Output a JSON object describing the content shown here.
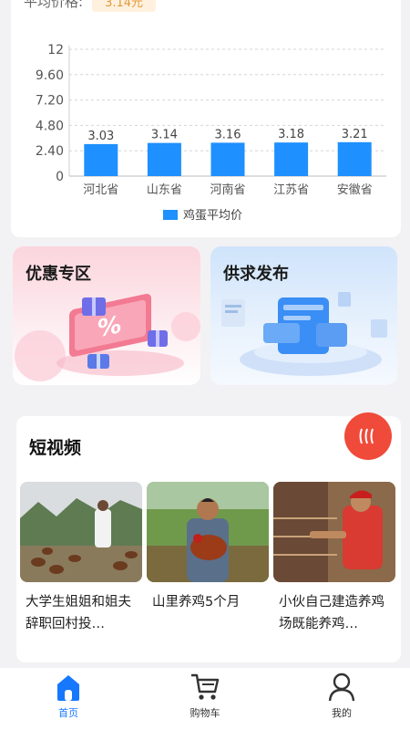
{
  "header": {
    "price_label": "平均价格:",
    "price_value": "3.14元"
  },
  "chart_data": {
    "type": "bar",
    "categories": [
      "河北省",
      "山东省",
      "河南省",
      "江苏省",
      "安徽省"
    ],
    "series": [
      {
        "name": "鸡蛋平均价",
        "values": [
          3.03,
          3.14,
          3.16,
          3.18,
          3.21
        ]
      }
    ],
    "yticks": [
      "0",
      "2.40",
      "4.80",
      "7.20",
      "9.60",
      "12"
    ],
    "ylim": [
      0,
      12
    ],
    "grid": true,
    "legend": "bottom",
    "bar_color": "#1e90ff"
  },
  "promos": {
    "discount_title": "优惠专区",
    "supply_title": "供求发布"
  },
  "video": {
    "section_title": "短视频",
    "more_icon": "wave-icon",
    "items": [
      {
        "caption": "大学生姐姐和姐夫辞职回村投…"
      },
      {
        "caption": "山里养鸡5个月"
      },
      {
        "caption": "小伙自己建造养鸡场既能养鸡…"
      }
    ]
  },
  "tabbar": {
    "home": "首页",
    "cart": "购物车",
    "mine": "我的",
    "active_color": "#1677ff"
  }
}
